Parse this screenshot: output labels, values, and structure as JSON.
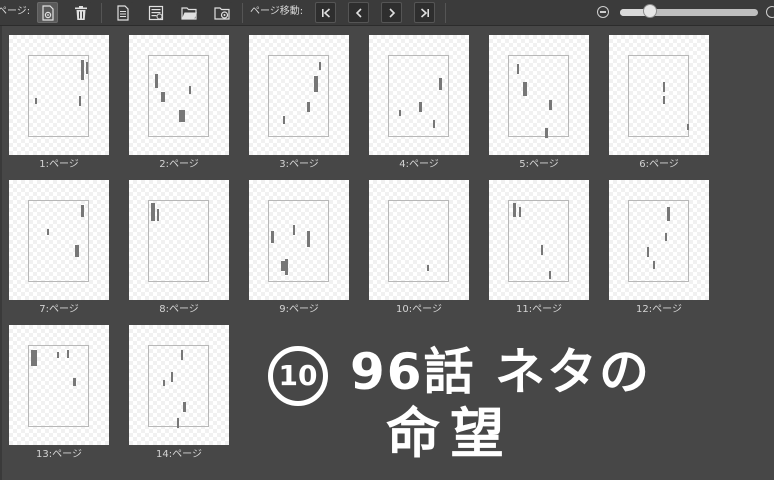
{
  "toolbar": {
    "page_label": "ページ:",
    "page_move_label": "ページ移動:",
    "icons": {
      "page_settings": "page-settings-icon",
      "delete": "trash-icon",
      "new_page": "new-page-icon",
      "page_list": "page-list-icon",
      "open_folder": "folder-icon",
      "folder_settings": "folder-settings-icon",
      "first_page": "first-page-icon",
      "prev_page": "previous-page-icon",
      "next_page": "next-page-icon",
      "last_page": "last-page-icon",
      "zoom_out": "zoom-out-icon",
      "zoom_in": "zoom-in-icon"
    },
    "zoom_level": 0.22
  },
  "pages": [
    {
      "label": "1:ページ"
    },
    {
      "label": "2:ページ"
    },
    {
      "label": "3:ページ"
    },
    {
      "label": "4:ページ"
    },
    {
      "label": "5:ページ"
    },
    {
      "label": "6:ページ"
    },
    {
      "label": "7:ページ"
    },
    {
      "label": "8:ページ"
    },
    {
      "label": "9:ページ"
    },
    {
      "label": "10:ページ"
    },
    {
      "label": "11:ページ"
    },
    {
      "label": "12:ページ"
    },
    {
      "label": "13:ページ"
    },
    {
      "label": "14:ページ"
    }
  ],
  "note": {
    "number": "10",
    "line1": "96話 ネタの",
    "line2": "命望"
  },
  "colors": {
    "background": "#474747",
    "toolbar": "#3b3b3b",
    "label_text": "#d4d4d4",
    "note_text": "#ffffff"
  }
}
